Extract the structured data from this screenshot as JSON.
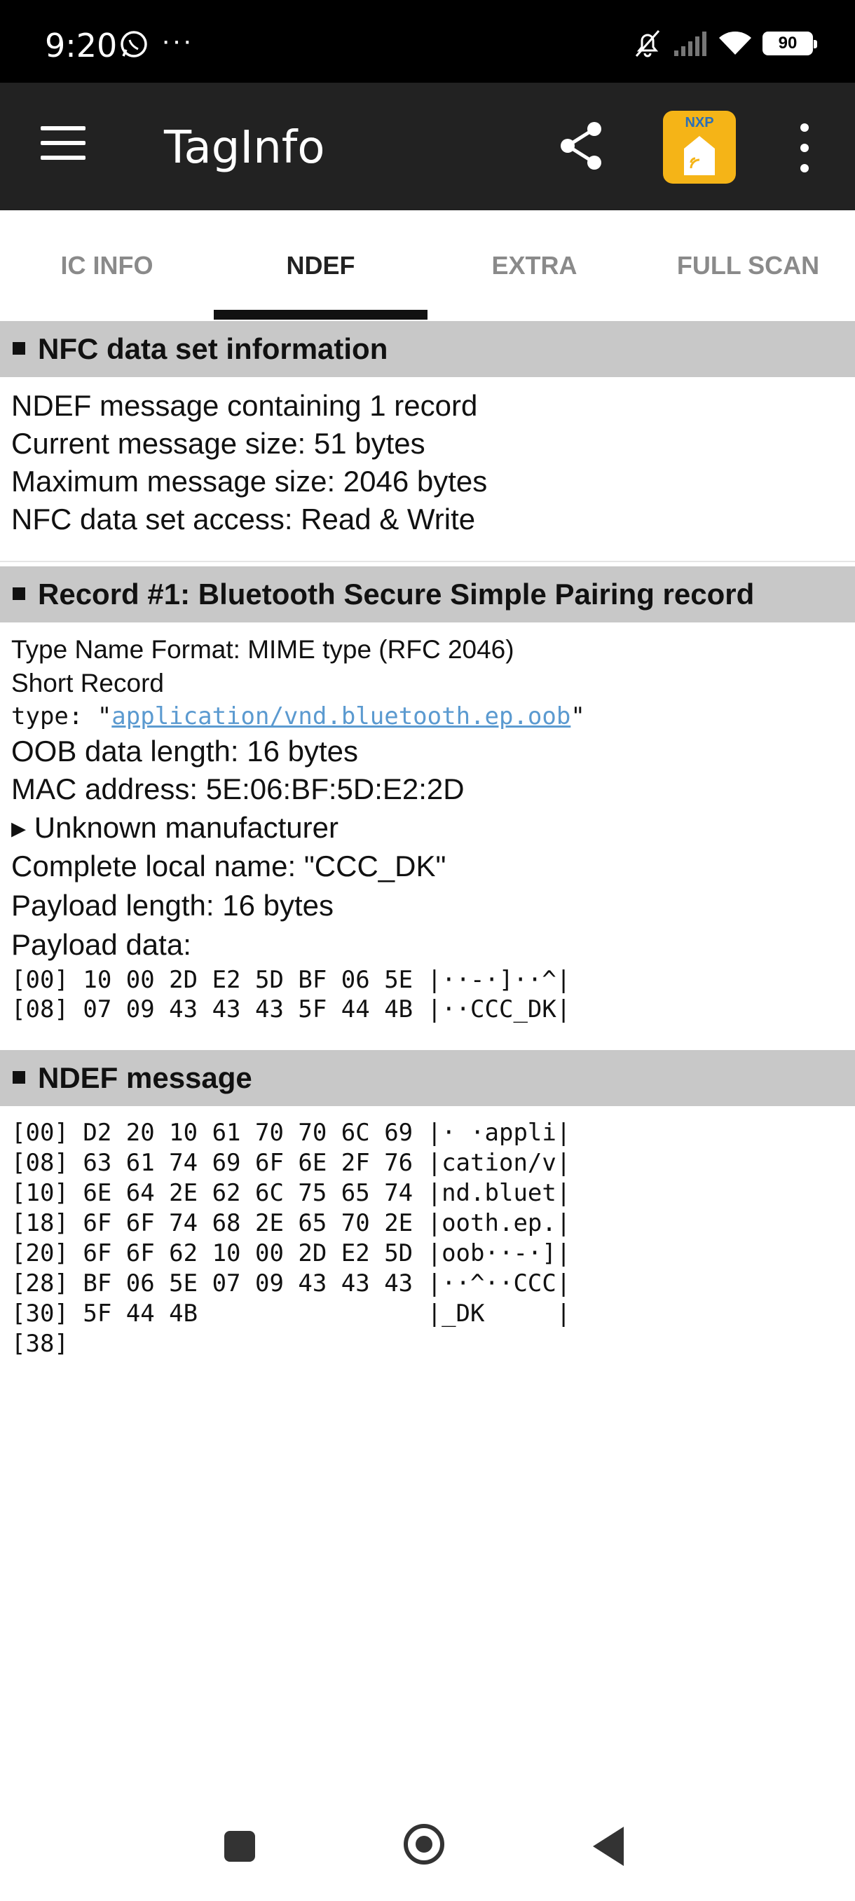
{
  "status_bar": {
    "time": "9:20",
    "dots": "···",
    "battery": "90"
  },
  "app_bar": {
    "title": "TagInfo",
    "nxp_logo_text": "NXP"
  },
  "tabs": [
    {
      "label": "IC INFO"
    },
    {
      "label": "NDEF",
      "active": true
    },
    {
      "label": "EXTRA"
    },
    {
      "label": "FULL SCAN"
    }
  ],
  "nfc_info": {
    "header": "NFC data set information",
    "lines": [
      "NDEF message containing 1 record",
      "Current message size: 51 bytes",
      "Maximum message size: 2046 bytes",
      "NFC data set access: Read & Write"
    ]
  },
  "record": {
    "header": "Record #1: Bluetooth Secure Simple Pairing record",
    "tnf": "Type Name Format: MIME type (RFC 2046)",
    "short_record": "Short Record",
    "type_prefix": "type: \"",
    "type_value": "application/vnd.bluetooth.ep.oob",
    "type_suffix": "\"",
    "oob_length": "OOB data length: 16 bytes",
    "mac": "MAC address: 5E:06:BF:5D:E2:2D",
    "manufacturer": "▸ Unknown manufacturer",
    "local_name": "Complete local name: \"CCC_DK\"",
    "payload_length": "Payload length: 16 bytes",
    "payload_label": "Payload data:",
    "payload_hex": [
      "[00] 10 00 2D E2 5D BF 06 5E |··-·]··^|",
      "[08] 07 09 43 43 43 5F 44 4B |··CCC_DK|"
    ]
  },
  "ndef_message": {
    "header": "NDEF message",
    "hex": [
      "[00] D2 20 10 61 70 70 6C 69 |· ·appli|",
      "[08] 63 61 74 69 6F 6E 2F 76 |cation/v|",
      "[10] 6E 64 2E 62 6C 75 65 74 |nd.bluet|",
      "[18] 6F 6F 74 68 2E 65 70 2E |ooth.ep.|",
      "[20] 6F 6F 62 10 00 2D E2 5D |oob··-·]|",
      "[28] BF 06 5E 07 09 43 43 43 |··^··CCC|",
      "[30] 5F 44 4B                |_DK     |",
      "[38]"
    ]
  },
  "colors": {
    "status_bar": "#000000",
    "app_bar": "#222222",
    "section_header": "#c8c8c8",
    "nxp_icon": "#f5b417",
    "link": "#5b9ad0"
  }
}
